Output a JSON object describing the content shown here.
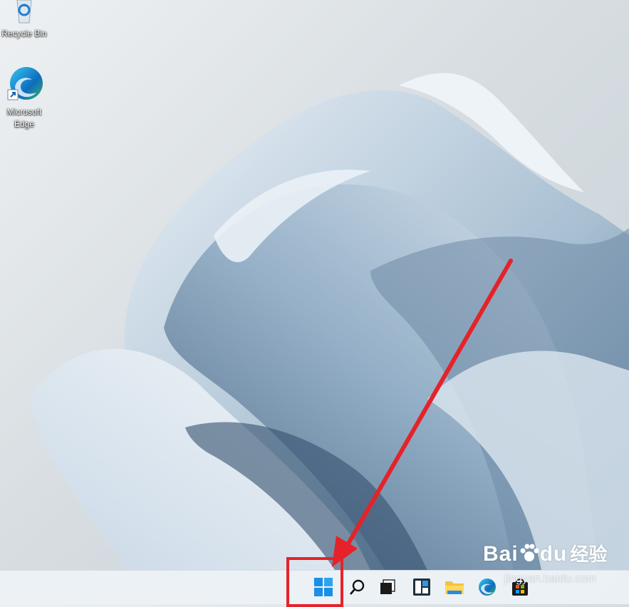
{
  "desktop": {
    "icons": [
      {
        "name": "recycle-bin",
        "label": "Recycle Bin"
      },
      {
        "name": "microsoft-edge",
        "label": "Microsoft Edge"
      }
    ]
  },
  "taskbar": {
    "icons": [
      {
        "name": "start-button",
        "icon": "windows-logo-icon"
      },
      {
        "name": "search-button",
        "icon": "search-icon"
      },
      {
        "name": "task-view-button",
        "icon": "task-view-icon"
      },
      {
        "name": "widgets-button",
        "icon": "widgets-icon"
      },
      {
        "name": "file-explorer-button",
        "icon": "folder-icon"
      },
      {
        "name": "edge-button",
        "icon": "edge-icon"
      },
      {
        "name": "store-button",
        "icon": "store-icon"
      }
    ]
  },
  "annotation": {
    "color": "#e5222a",
    "target": "start-button"
  },
  "watermark": {
    "brand": "Bai",
    "brand_mid": "du",
    "cn": "经验",
    "url": "jingyan.baidu.com"
  }
}
